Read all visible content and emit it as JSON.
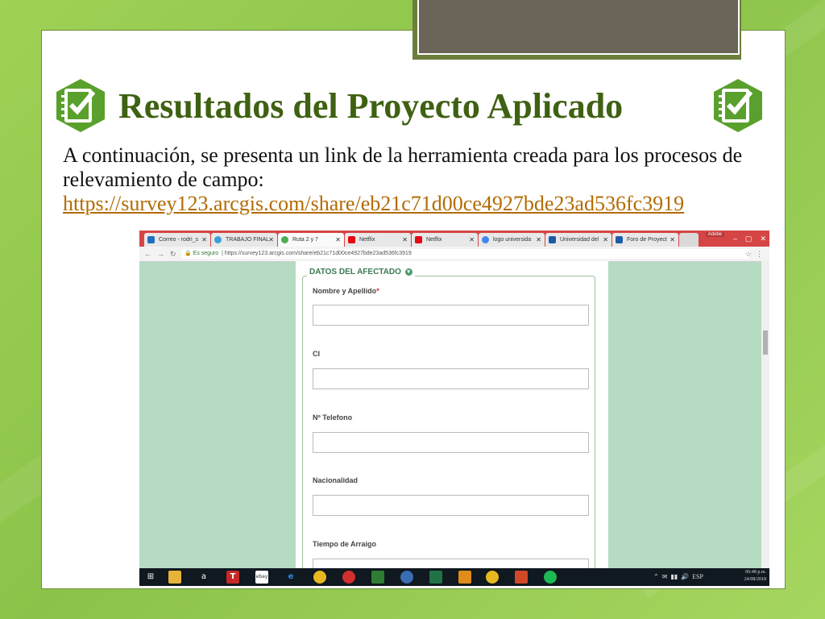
{
  "slide": {
    "title": "Resultados del Proyecto Aplicado",
    "body_text": "A continuación, se presenta un link de la herramienta creada para los procesos de relevamiento de campo:",
    "link": "https://survey123.arcgis.com/share/eb21c71d00ce4927bde23ad536fc3919",
    "title_icon": "survey-checklist-icon",
    "colors": {
      "title": "#3f6112",
      "link": "#b36b00",
      "background": "#8bc34a"
    }
  },
  "browser": {
    "tabs": [
      {
        "label": "Correo - rodri_s",
        "icon": "outlook-icon"
      },
      {
        "label": "TRABAJO FINAL",
        "icon": "web-icon"
      },
      {
        "label": "Ruta 2 y 7",
        "icon": "survey123-icon"
      },
      {
        "label": "Netflix",
        "icon": "netflix-icon"
      },
      {
        "label": "Netflix",
        "icon": "netflix-icon"
      },
      {
        "label": "logo universida",
        "icon": "google-icon"
      },
      {
        "label": "Universidad del",
        "icon": "university-icon"
      },
      {
        "label": "Foro de Proyect",
        "icon": "university-icon"
      }
    ],
    "adobe_label": "Adobe",
    "window_buttons": [
      "–",
      "▢",
      "✕"
    ],
    "security_label": "Es seguro",
    "url": "https://survey123.arcgis.com/share/eb21c71d00ce4927bde23ad536fc3919"
  },
  "form": {
    "section_title": "DATOS DEL AFECTADO",
    "fields": [
      {
        "label": "Nombre y Apellido",
        "required": "*"
      },
      {
        "label": "CI"
      },
      {
        "label": "Nº Telefono"
      },
      {
        "label": "Nacionalidad"
      },
      {
        "label": "Tiempo de Arraigo"
      }
    ]
  },
  "taskbar": {
    "time": "06:48 p.m.",
    "date": "24/08/2018",
    "language": "ESP",
    "apps": [
      "windows-start-icon",
      "file-explorer-icon",
      "amazon-icon",
      "t-app-icon",
      "ebay-icon",
      "edge-icon",
      "chrome-icon",
      "opera-icon",
      "store-icon",
      "search-app-icon",
      "excel-icon",
      "media-icon",
      "chrome-icon",
      "powerpoint-icon",
      "spotify-icon"
    ]
  }
}
